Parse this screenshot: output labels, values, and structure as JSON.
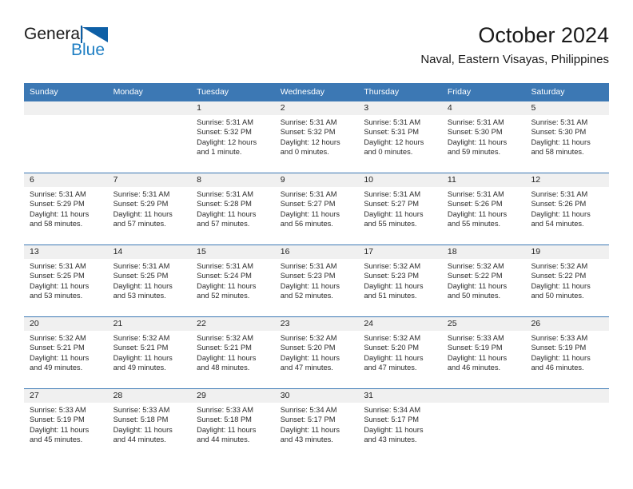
{
  "brand": {
    "name_part1": "General",
    "name_part2": "Blue",
    "flag_icon": "blue-flag-triangle"
  },
  "header": {
    "title": "October 2024",
    "subtitle": "Naval, Eastern Visayas, Philippines"
  },
  "colors": {
    "header_blue": "#3c78b4",
    "logo_blue": "#1f7fc4",
    "daynum_bg": "#f0f0f0",
    "text": "#1a1a1a"
  },
  "weekdays": [
    "Sunday",
    "Monday",
    "Tuesday",
    "Wednesday",
    "Thursday",
    "Friday",
    "Saturday"
  ],
  "weeks": [
    [
      {
        "day": "",
        "sunrise": "",
        "sunset": "",
        "daylight": "",
        "daylight2": "",
        "empty": true
      },
      {
        "day": "",
        "sunrise": "",
        "sunset": "",
        "daylight": "",
        "daylight2": "",
        "empty": true
      },
      {
        "day": "1",
        "sunrise": "Sunrise: 5:31 AM",
        "sunset": "Sunset: 5:32 PM",
        "daylight": "Daylight: 12 hours",
        "daylight2": "and 1 minute."
      },
      {
        "day": "2",
        "sunrise": "Sunrise: 5:31 AM",
        "sunset": "Sunset: 5:32 PM",
        "daylight": "Daylight: 12 hours",
        "daylight2": "and 0 minutes."
      },
      {
        "day": "3",
        "sunrise": "Sunrise: 5:31 AM",
        "sunset": "Sunset: 5:31 PM",
        "daylight": "Daylight: 12 hours",
        "daylight2": "and 0 minutes."
      },
      {
        "day": "4",
        "sunrise": "Sunrise: 5:31 AM",
        "sunset": "Sunset: 5:30 PM",
        "daylight": "Daylight: 11 hours",
        "daylight2": "and 59 minutes."
      },
      {
        "day": "5",
        "sunrise": "Sunrise: 5:31 AM",
        "sunset": "Sunset: 5:30 PM",
        "daylight": "Daylight: 11 hours",
        "daylight2": "and 58 minutes."
      }
    ],
    [
      {
        "day": "6",
        "sunrise": "Sunrise: 5:31 AM",
        "sunset": "Sunset: 5:29 PM",
        "daylight": "Daylight: 11 hours",
        "daylight2": "and 58 minutes."
      },
      {
        "day": "7",
        "sunrise": "Sunrise: 5:31 AM",
        "sunset": "Sunset: 5:29 PM",
        "daylight": "Daylight: 11 hours",
        "daylight2": "and 57 minutes."
      },
      {
        "day": "8",
        "sunrise": "Sunrise: 5:31 AM",
        "sunset": "Sunset: 5:28 PM",
        "daylight": "Daylight: 11 hours",
        "daylight2": "and 57 minutes."
      },
      {
        "day": "9",
        "sunrise": "Sunrise: 5:31 AM",
        "sunset": "Sunset: 5:27 PM",
        "daylight": "Daylight: 11 hours",
        "daylight2": "and 56 minutes."
      },
      {
        "day": "10",
        "sunrise": "Sunrise: 5:31 AM",
        "sunset": "Sunset: 5:27 PM",
        "daylight": "Daylight: 11 hours",
        "daylight2": "and 55 minutes."
      },
      {
        "day": "11",
        "sunrise": "Sunrise: 5:31 AM",
        "sunset": "Sunset: 5:26 PM",
        "daylight": "Daylight: 11 hours",
        "daylight2": "and 55 minutes."
      },
      {
        "day": "12",
        "sunrise": "Sunrise: 5:31 AM",
        "sunset": "Sunset: 5:26 PM",
        "daylight": "Daylight: 11 hours",
        "daylight2": "and 54 minutes."
      }
    ],
    [
      {
        "day": "13",
        "sunrise": "Sunrise: 5:31 AM",
        "sunset": "Sunset: 5:25 PM",
        "daylight": "Daylight: 11 hours",
        "daylight2": "and 53 minutes."
      },
      {
        "day": "14",
        "sunrise": "Sunrise: 5:31 AM",
        "sunset": "Sunset: 5:25 PM",
        "daylight": "Daylight: 11 hours",
        "daylight2": "and 53 minutes."
      },
      {
        "day": "15",
        "sunrise": "Sunrise: 5:31 AM",
        "sunset": "Sunset: 5:24 PM",
        "daylight": "Daylight: 11 hours",
        "daylight2": "and 52 minutes."
      },
      {
        "day": "16",
        "sunrise": "Sunrise: 5:31 AM",
        "sunset": "Sunset: 5:23 PM",
        "daylight": "Daylight: 11 hours",
        "daylight2": "and 52 minutes."
      },
      {
        "day": "17",
        "sunrise": "Sunrise: 5:32 AM",
        "sunset": "Sunset: 5:23 PM",
        "daylight": "Daylight: 11 hours",
        "daylight2": "and 51 minutes."
      },
      {
        "day": "18",
        "sunrise": "Sunrise: 5:32 AM",
        "sunset": "Sunset: 5:22 PM",
        "daylight": "Daylight: 11 hours",
        "daylight2": "and 50 minutes."
      },
      {
        "day": "19",
        "sunrise": "Sunrise: 5:32 AM",
        "sunset": "Sunset: 5:22 PM",
        "daylight": "Daylight: 11 hours",
        "daylight2": "and 50 minutes."
      }
    ],
    [
      {
        "day": "20",
        "sunrise": "Sunrise: 5:32 AM",
        "sunset": "Sunset: 5:21 PM",
        "daylight": "Daylight: 11 hours",
        "daylight2": "and 49 minutes."
      },
      {
        "day": "21",
        "sunrise": "Sunrise: 5:32 AM",
        "sunset": "Sunset: 5:21 PM",
        "daylight": "Daylight: 11 hours",
        "daylight2": "and 49 minutes."
      },
      {
        "day": "22",
        "sunrise": "Sunrise: 5:32 AM",
        "sunset": "Sunset: 5:21 PM",
        "daylight": "Daylight: 11 hours",
        "daylight2": "and 48 minutes."
      },
      {
        "day": "23",
        "sunrise": "Sunrise: 5:32 AM",
        "sunset": "Sunset: 5:20 PM",
        "daylight": "Daylight: 11 hours",
        "daylight2": "and 47 minutes."
      },
      {
        "day": "24",
        "sunrise": "Sunrise: 5:32 AM",
        "sunset": "Sunset: 5:20 PM",
        "daylight": "Daylight: 11 hours",
        "daylight2": "and 47 minutes."
      },
      {
        "day": "25",
        "sunrise": "Sunrise: 5:33 AM",
        "sunset": "Sunset: 5:19 PM",
        "daylight": "Daylight: 11 hours",
        "daylight2": "and 46 minutes."
      },
      {
        "day": "26",
        "sunrise": "Sunrise: 5:33 AM",
        "sunset": "Sunset: 5:19 PM",
        "daylight": "Daylight: 11 hours",
        "daylight2": "and 46 minutes."
      }
    ],
    [
      {
        "day": "27",
        "sunrise": "Sunrise: 5:33 AM",
        "sunset": "Sunset: 5:19 PM",
        "daylight": "Daylight: 11 hours",
        "daylight2": "and 45 minutes."
      },
      {
        "day": "28",
        "sunrise": "Sunrise: 5:33 AM",
        "sunset": "Sunset: 5:18 PM",
        "daylight": "Daylight: 11 hours",
        "daylight2": "and 44 minutes."
      },
      {
        "day": "29",
        "sunrise": "Sunrise: 5:33 AM",
        "sunset": "Sunset: 5:18 PM",
        "daylight": "Daylight: 11 hours",
        "daylight2": "and 44 minutes."
      },
      {
        "day": "30",
        "sunrise": "Sunrise: 5:34 AM",
        "sunset": "Sunset: 5:17 PM",
        "daylight": "Daylight: 11 hours",
        "daylight2": "and 43 minutes."
      },
      {
        "day": "31",
        "sunrise": "Sunrise: 5:34 AM",
        "sunset": "Sunset: 5:17 PM",
        "daylight": "Daylight: 11 hours",
        "daylight2": "and 43 minutes."
      },
      {
        "day": "",
        "sunrise": "",
        "sunset": "",
        "daylight": "",
        "daylight2": "",
        "empty": true
      },
      {
        "day": "",
        "sunrise": "",
        "sunset": "",
        "daylight": "",
        "daylight2": "",
        "empty": true
      }
    ]
  ]
}
